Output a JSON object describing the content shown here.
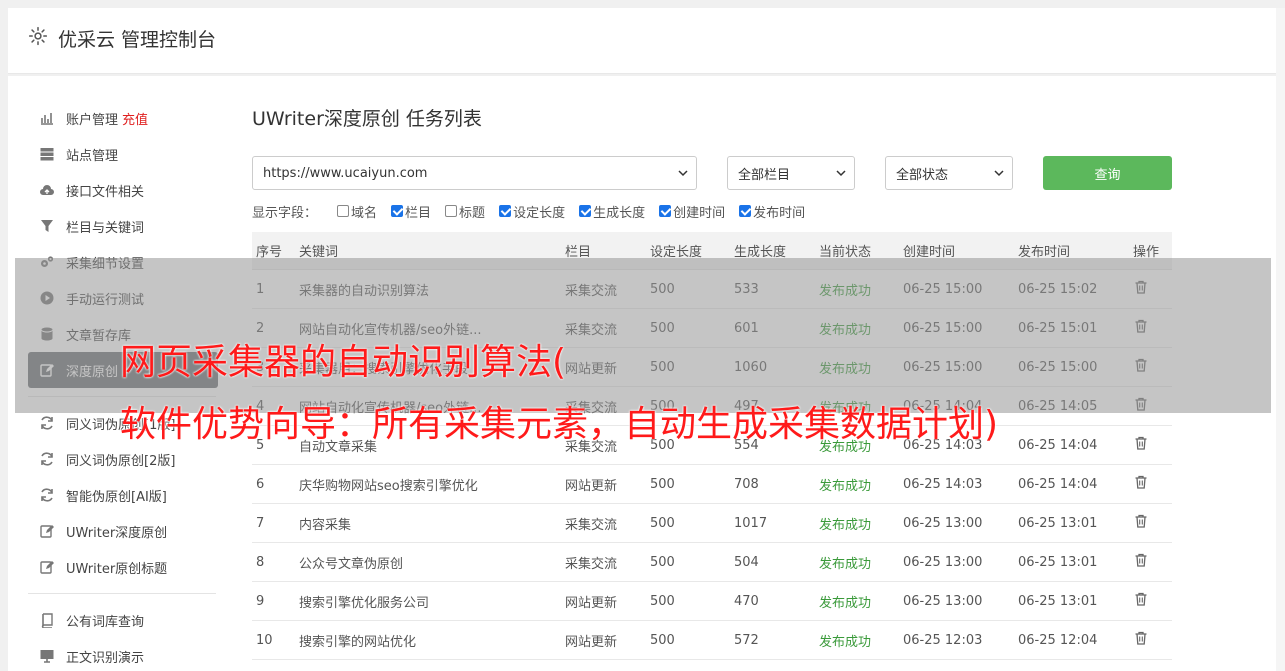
{
  "header": {
    "title": "优采云 管理控制台",
    "icon": "gear-icon"
  },
  "sidebar": {
    "items": [
      {
        "label": "账户管理",
        "extra": "充值",
        "icon": "bar-chart-icon"
      },
      {
        "label": "站点管理",
        "icon": "server-icon"
      },
      {
        "label": "接口文件相关",
        "icon": "cloud-upload-icon"
      },
      {
        "label": "栏目与关键词",
        "icon": "filter-icon"
      },
      {
        "label": "采集细节设置",
        "icon": "gears-icon"
      },
      {
        "label": "手动运行测试",
        "icon": "play-circle-icon"
      },
      {
        "label": "文章暂存库",
        "icon": "database-icon"
      },
      {
        "label": "深度原创",
        "icon": "edit-icon",
        "active": true
      },
      {
        "label": "同义词伪原创[1版]",
        "icon": "refresh-icon"
      },
      {
        "label": "同义词伪原创[2版]",
        "icon": "refresh-icon"
      },
      {
        "label": "智能伪原创[AI版]",
        "icon": "refresh-icon"
      },
      {
        "label": "UWriter深度原创",
        "icon": "edit-icon"
      },
      {
        "label": "UWriter原创标题",
        "icon": "edit-icon"
      },
      {
        "label": "公有词库查询",
        "icon": "book-icon"
      },
      {
        "label": "正文识别演示",
        "icon": "monitor-icon"
      }
    ]
  },
  "main": {
    "title": "UWriter深度原创 任务列表",
    "filters": {
      "site": "https://www.ucaiyun.com",
      "column": "全部栏目",
      "status": "全部状态",
      "query_label": "查询"
    },
    "fields": {
      "label": "显示字段：",
      "options": [
        {
          "label": "域名",
          "checked": false
        },
        {
          "label": "栏目",
          "checked": true
        },
        {
          "label": "标题",
          "checked": false
        },
        {
          "label": "设定长度",
          "checked": true
        },
        {
          "label": "生成长度",
          "checked": true
        },
        {
          "label": "创建时间",
          "checked": true
        },
        {
          "label": "发布时间",
          "checked": true
        }
      ]
    },
    "table": {
      "headers": [
        "序号",
        "关键词",
        "栏目",
        "设定长度",
        "生成长度",
        "当前状态",
        "创建时间",
        "发布时间",
        "操作"
      ],
      "rows": [
        [
          "1",
          "采集器的自动识别算法",
          "采集交流",
          "500",
          "533",
          "发布成功",
          "06-25 15:00",
          "06-25 15:02"
        ],
        [
          "2",
          "网站自动化宣传机器/seo外链...",
          "采集交流",
          "500",
          "601",
          "发布成功",
          "06-25 15:00",
          "06-25 15:01"
        ],
        [
          "3",
          "采集器用：搜索引擎优化手段",
          "网站更新",
          "500",
          "1060",
          "发布成功",
          "06-25 15:00",
          "06-25 15:00"
        ],
        [
          "4",
          "网站自动化宣传机器/seo外链...",
          "采集交流",
          "500",
          "497",
          "发布成功",
          "06-25 14:04",
          "06-25 14:05"
        ],
        [
          "5",
          "自动文章采集",
          "采集交流",
          "500",
          "554",
          "发布成功",
          "06-25 14:03",
          "06-25 14:04"
        ],
        [
          "6",
          "庆华购物网站seo搜索引擎优化",
          "网站更新",
          "500",
          "708",
          "发布成功",
          "06-25 14:03",
          "06-25 14:04"
        ],
        [
          "7",
          "内容采集",
          "采集交流",
          "500",
          "1017",
          "发布成功",
          "06-25 13:00",
          "06-25 13:01"
        ],
        [
          "8",
          "公众号文章伪原创",
          "采集交流",
          "500",
          "504",
          "发布成功",
          "06-25 13:00",
          "06-25 13:01"
        ],
        [
          "9",
          "搜索引擎优化服务公司",
          "网站更新",
          "500",
          "470",
          "发布成功",
          "06-25 13:00",
          "06-25 13:01"
        ],
        [
          "10",
          "搜索引擎的网站优化",
          "网站更新",
          "500",
          "572",
          "发布成功",
          "06-25 12:03",
          "06-25 12:04"
        ]
      ]
    }
  },
  "overlay": {
    "line1": "网页采集器的自动识别算法(",
    "line2": "软件优势向导：所有采集元素，自动生成采集数据计划)"
  },
  "colors": {
    "accent_green": "#5cb85c",
    "status_green": "#3a9a3a",
    "overlay_red": "#ff1a1a",
    "active_bg": "#6d7175"
  }
}
